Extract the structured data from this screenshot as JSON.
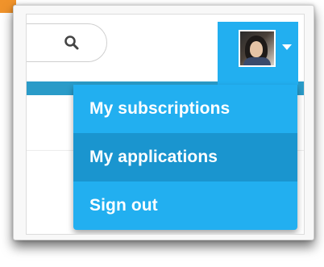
{
  "header": {
    "search": {
      "icon": "search-icon"
    },
    "user_menu": {
      "avatar": "user-avatar",
      "caret_icon": "caret-down-icon"
    }
  },
  "dropdown": {
    "items": [
      {
        "label": "My subscriptions",
        "active": false
      },
      {
        "label": "My applications",
        "active": true
      },
      {
        "label": "Sign out",
        "active": false
      }
    ]
  },
  "colors": {
    "accent": "#22aff0",
    "accent_active": "#1a95cf",
    "strip": "#2a9bc8",
    "corner": "#f0932b"
  }
}
